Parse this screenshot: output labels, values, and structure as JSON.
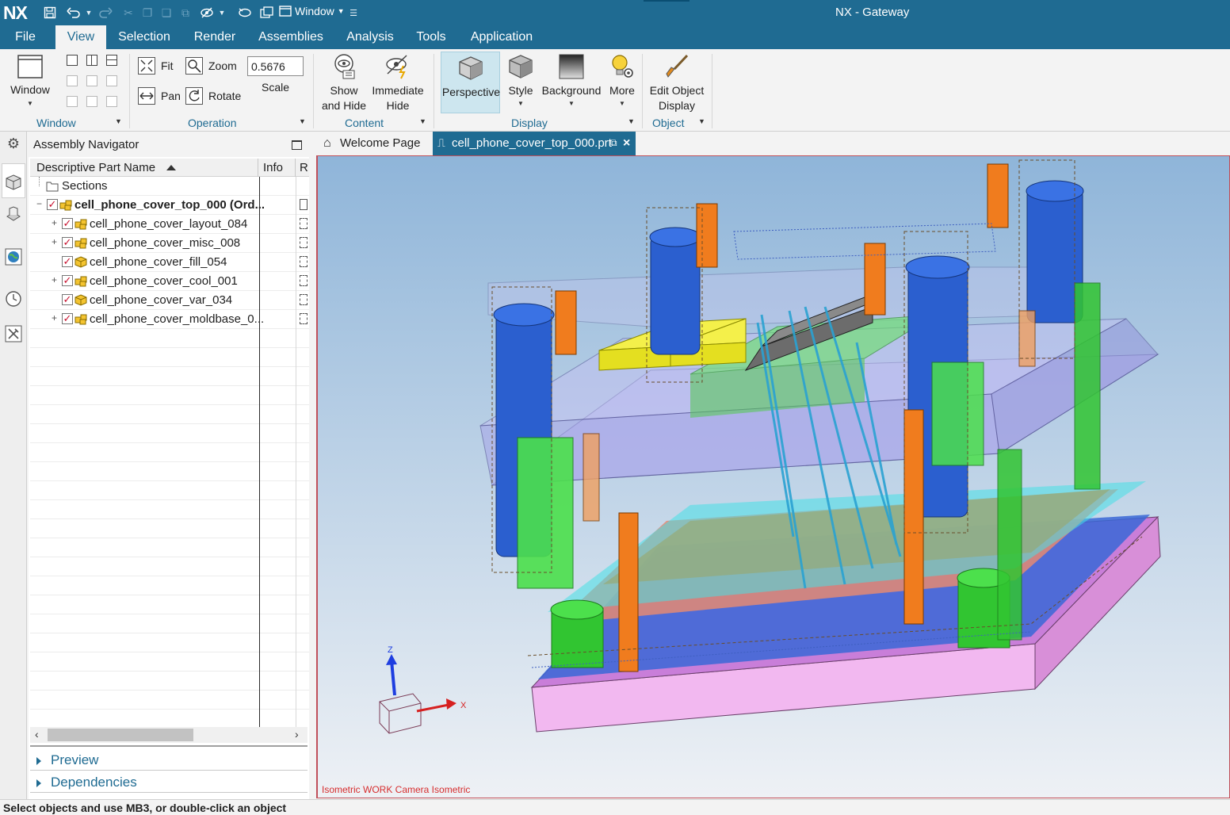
{
  "app": {
    "logo": "NX",
    "title": "NX - Gateway",
    "window_menu_label": "Window",
    "accent": "#1f6b92"
  },
  "menu": {
    "tabs": [
      "File",
      "View",
      "Selection",
      "Render",
      "Assemblies",
      "Analysis",
      "Tools",
      "Application"
    ],
    "active": "View"
  },
  "ribbon": {
    "window_group": {
      "label": "Window",
      "button": "Window"
    },
    "operation_group": {
      "label": "Operation",
      "fit": "Fit",
      "zoom": "Zoom",
      "pan": "Pan",
      "rotate": "Rotate",
      "scale_value": "0.5676",
      "scale_label": "Scale"
    },
    "content_group": {
      "label": "Content",
      "show_hide_1": "Show",
      "show_hide_2": "and Hide",
      "immediate_1": "Immediate",
      "immediate_2": "Hide"
    },
    "display_group": {
      "label": "Display",
      "perspective": "Perspective",
      "style": "Style",
      "background": "Background",
      "more": "More"
    },
    "object_group": {
      "label": "Object",
      "edit_1": "Edit Object",
      "edit_2": "Display"
    }
  },
  "navigator": {
    "title": "Assembly Navigator",
    "columns": {
      "name": "Descriptive Part Name",
      "info": "Info",
      "r": "R"
    },
    "rows": [
      {
        "label": "Sections",
        "kind": "folder",
        "indent": 0
      },
      {
        "label": "cell_phone_cover_top_000 (Ord...",
        "kind": "assembly",
        "expand": "−",
        "checked": true,
        "bold": true,
        "indent": 0
      },
      {
        "label": "cell_phone_cover_layout_084",
        "kind": "assembly",
        "expand": "+",
        "checked": true,
        "indent": 1
      },
      {
        "label": "cell_phone_cover_misc_008",
        "kind": "assembly",
        "expand": "+",
        "checked": true,
        "indent": 1
      },
      {
        "label": "cell_phone_cover_fill_054",
        "kind": "part",
        "checked": true,
        "indent": 1
      },
      {
        "label": "cell_phone_cover_cool_001",
        "kind": "assembly",
        "expand": "+",
        "checked": true,
        "indent": 1
      },
      {
        "label": "cell_phone_cover_var_034",
        "kind": "part",
        "checked": true,
        "indent": 1
      },
      {
        "label": "cell_phone_cover_moldbase_0...",
        "kind": "assembly",
        "expand": "+",
        "checked": true,
        "indent": 1
      }
    ],
    "preview": "Preview",
    "dependencies": "Dependencies"
  },
  "doc_tabs": {
    "welcome": "Welcome Page",
    "active_file": "cell_phone_cover_top_000.prt"
  },
  "viewport": {
    "caption": "Isometric WORK Camera Isometric",
    "axis_z": "Z",
    "axis_x": "X"
  },
  "status": "Select objects and use MB3, or double-click an object"
}
